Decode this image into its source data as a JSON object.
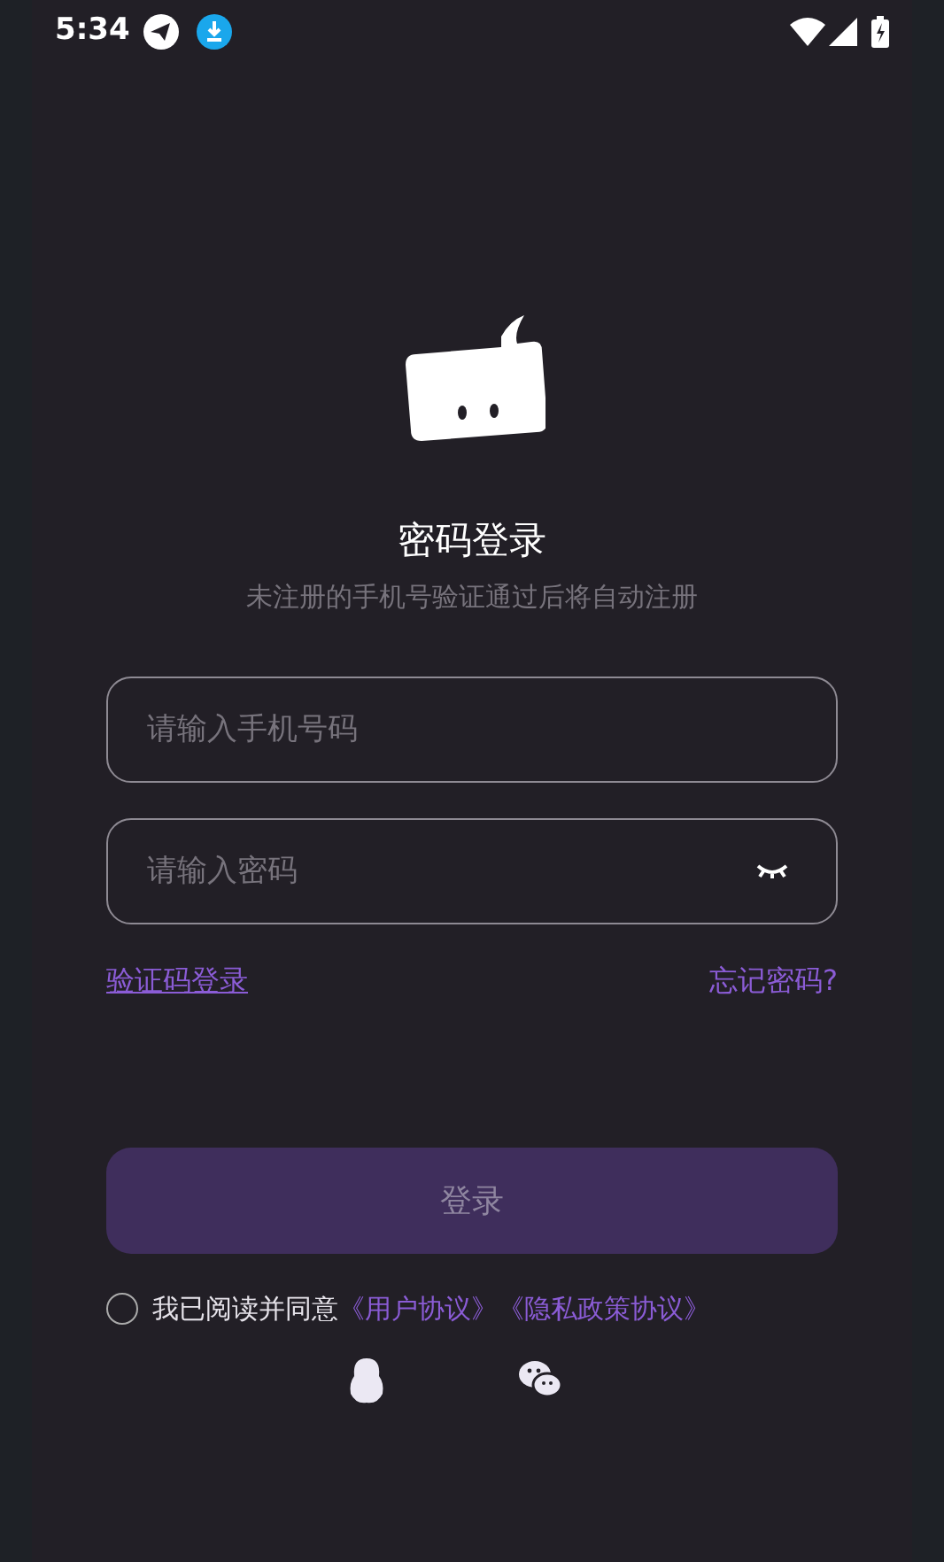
{
  "status_bar": {
    "time": "5:34"
  },
  "title": "密码登录",
  "subtitle": "未注册的手机号验证通过后将自动注册",
  "phone_field": {
    "placeholder": "请输入手机号码"
  },
  "password_field": {
    "placeholder": "请输入密码"
  },
  "sms_login_link": "验证码登录",
  "forgot_link": "忘记密码?",
  "login_button": {
    "label": "登录",
    "disabled": true
  },
  "agreement": {
    "checked": false,
    "text": "我已阅读并同意",
    "links": [
      "《用户协议》",
      "《隐私政策协议》"
    ]
  }
}
